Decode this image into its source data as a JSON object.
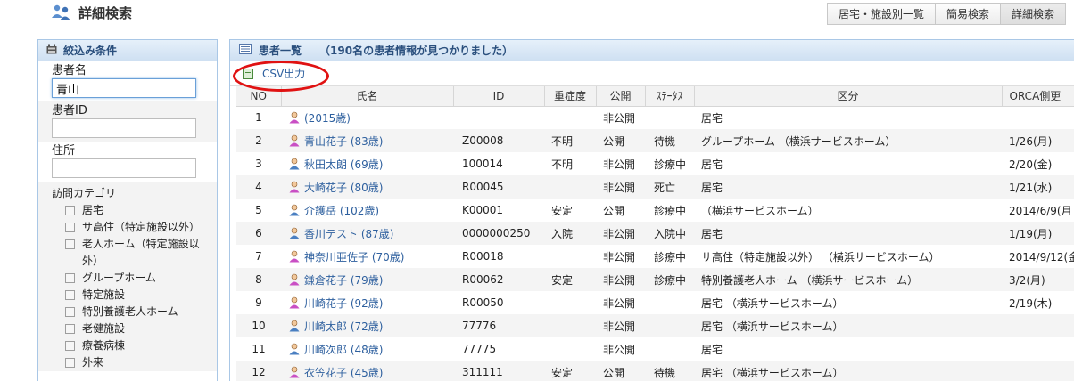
{
  "page": {
    "title": "詳細検索"
  },
  "top_tabs": [
    "居宅・施設別一覧",
    "簡易検索",
    "詳細検索"
  ],
  "sidebar": {
    "title": "絞込み条件",
    "patient_name": {
      "label": "患者名",
      "value": "青山"
    },
    "patient_id": {
      "label": "患者ID",
      "value": ""
    },
    "address": {
      "label": "住所",
      "value": ""
    },
    "category": {
      "label": "訪問カテゴリ",
      "items": [
        "居宅",
        "サ高住（特定施設以外）",
        "老人ホーム（特定施設以外）",
        "グループホーム",
        "特定施設",
        "特別養護老人ホーム",
        "老健施設",
        "療養病棟",
        "外来"
      ]
    }
  },
  "main": {
    "title": "患者一覧",
    "result_text": "（190名の患者情報が見つかりました）",
    "csv_label": "CSV出力",
    "columns": [
      "NO",
      "氏名",
      "ID",
      "重症度",
      "公開",
      "ｽﾃｰﾀｽ",
      "区分",
      "ORCA側更"
    ],
    "rows": [
      {
        "no": "1",
        "name": "(2015歳)",
        "gender": "female",
        "id": "",
        "severity": "",
        "public": "非公開",
        "status": "",
        "category": "居宅",
        "orca": ""
      },
      {
        "no": "2",
        "name": "青山花子 (83歳)",
        "gender": "female",
        "id": "Z00008",
        "severity": "不明",
        "public": "公開",
        "status": "待機",
        "category": "グループホーム （横浜サービスホーム）",
        "orca": "1/26(月)"
      },
      {
        "no": "3",
        "name": "秋田太朗 (69歳)",
        "gender": "male",
        "id": "100014",
        "severity": "不明",
        "public": "非公開",
        "status": "診療中",
        "category": "居宅",
        "orca": "2/20(金)"
      },
      {
        "no": "4",
        "name": "大崎花子 (80歳)",
        "gender": "female",
        "id": "R00045",
        "severity": "",
        "public": "非公開",
        "status": "死亡",
        "category": "居宅",
        "orca": "1/21(水)"
      },
      {
        "no": "5",
        "name": "介護岳 (102歳)",
        "gender": "male",
        "id": "K00001",
        "severity": "安定",
        "public": "公開",
        "status": "診療中",
        "category": "（横浜サービスホーム）",
        "orca": "2014/6/9(月"
      },
      {
        "no": "6",
        "name": "香川テスト (87歳)",
        "gender": "male",
        "id": "0000000250",
        "severity": "入院",
        "public": "非公開",
        "status": "入院中",
        "category": "居宅",
        "orca": "1/19(月)"
      },
      {
        "no": "7",
        "name": "神奈川亜佐子 (70歳)",
        "gender": "female",
        "id": "R00018",
        "severity": "",
        "public": "非公開",
        "status": "診療中",
        "category": "サ高住（特定施設以外） （横浜サービスホーム）",
        "orca": "2014/9/12(金"
      },
      {
        "no": "8",
        "name": "鎌倉花子 (79歳)",
        "gender": "female",
        "id": "R00062",
        "severity": "安定",
        "public": "非公開",
        "status": "診療中",
        "category": "特別養護老人ホーム （横浜サービスホーム）",
        "orca": "3/2(月)"
      },
      {
        "no": "9",
        "name": "川崎花子 (92歳)",
        "gender": "female",
        "id": "R00050",
        "severity": "",
        "public": "非公開",
        "status": "",
        "category": "居宅 （横浜サービスホーム）",
        "orca": "2/19(木)"
      },
      {
        "no": "10",
        "name": "川崎太郎 (72歳)",
        "gender": "male",
        "id": "77776",
        "severity": "",
        "public": "非公開",
        "status": "",
        "category": "居宅 （横浜サービスホーム）",
        "orca": ""
      },
      {
        "no": "11",
        "name": "川崎次郎 (48歳)",
        "gender": "male",
        "id": "77775",
        "severity": "",
        "public": "非公開",
        "status": "",
        "category": "居宅",
        "orca": ""
      },
      {
        "no": "12",
        "name": "衣笠花子 (45歳)",
        "gender": "female",
        "id": "311111",
        "severity": "安定",
        "public": "公開",
        "status": "待機",
        "category": "居宅 （横浜サービスホーム）",
        "orca": ""
      }
    ]
  },
  "colors": {
    "header_blue": "#2a4f7d",
    "link_blue": "#2d5f9e",
    "panel_border": "#a9c7e6",
    "highlight_red": "#e01212",
    "male_icon": "#4a7fc1",
    "female_icon": "#c94fc4"
  }
}
